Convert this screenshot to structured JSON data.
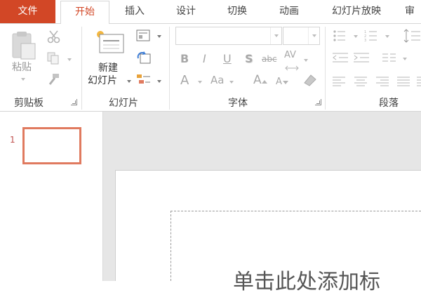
{
  "tabs": {
    "file": "文件",
    "home": "开始",
    "insert": "插入",
    "design": "设计",
    "transitions": "切换",
    "animations": "动画",
    "slideshow": "幻灯片放映",
    "review_partial": "审"
  },
  "ribbon": {
    "clipboard": {
      "label": "剪贴板",
      "paste_label": "粘贴"
    },
    "slides": {
      "label": "幻灯片",
      "new_slide_line1": "新建",
      "new_slide_line2": "幻灯片"
    },
    "font": {
      "label": "字体",
      "font_name_value": "",
      "font_size_value": "",
      "bold": "B",
      "italic": "I",
      "underline": "U",
      "shadow": "S",
      "strikethrough": "abc",
      "spacing": "AV",
      "font_color": "A",
      "change_case": "Aa",
      "grow": "A",
      "shrink": "A"
    },
    "paragraph": {
      "label": "段落"
    }
  },
  "thumbnails": [
    {
      "number": "1"
    }
  ],
  "slide": {
    "title_placeholder": "单击此处添加标"
  },
  "colors": {
    "accent": "#d24726",
    "thumb_border": "#e07a5f",
    "workspace_bg": "#e6e6e6"
  }
}
